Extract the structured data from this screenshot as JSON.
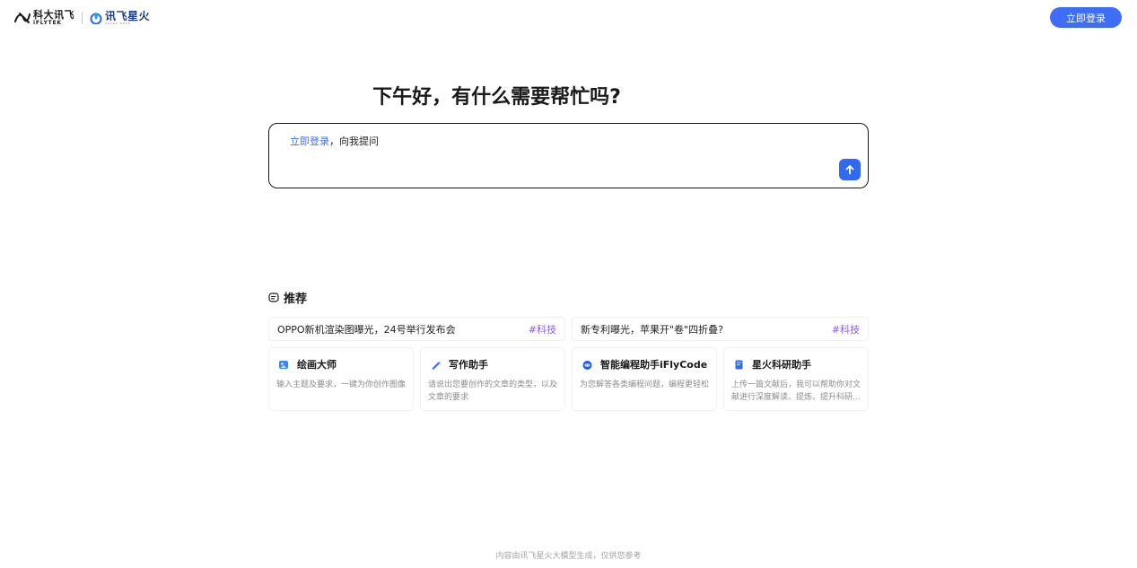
{
  "header": {
    "logo_cn": "科大讯飞",
    "logo_en": "iFLYTEK",
    "spark_cn": "讯飞星火",
    "spark_en": "SPARK DESK",
    "login_button": "立即登录"
  },
  "main": {
    "greeting": "下午好，有什么需要帮忙吗?",
    "input": {
      "login_link": "立即登录",
      "prompt_suffix": "，向我提问"
    }
  },
  "recommend": {
    "title": "推荐",
    "news": [
      {
        "text": "OPPO新机渲染图曝光，24号举行发布会",
        "tag": "#科技"
      },
      {
        "text": "新专利曝光，苹果开\"卷\"四折叠?",
        "tag": "#科技"
      }
    ],
    "tools": [
      {
        "icon": "paint-icon",
        "title": "绘画大师",
        "desc": "输入主题及要求，一键为你创作图像"
      },
      {
        "icon": "pen-icon",
        "title": "写作助手",
        "desc": "请说出您要创作的文章的类型，以及文章的要求"
      },
      {
        "icon": "robot-icon",
        "title": "智能编程助手iFlyCode",
        "desc": "为您解答各类编程问题，编程更轻松"
      },
      {
        "icon": "book-icon",
        "title": "星火科研助手",
        "desc": "上传一篇文献后，我可以帮助你对文献进行深度解读、提炼、提升科研..."
      }
    ]
  },
  "footer": {
    "text": "内容由讯飞星火大模型生成，仅供您参考"
  },
  "colors": {
    "accent": "#3d6ef5",
    "tag": "#8a5cf6"
  }
}
